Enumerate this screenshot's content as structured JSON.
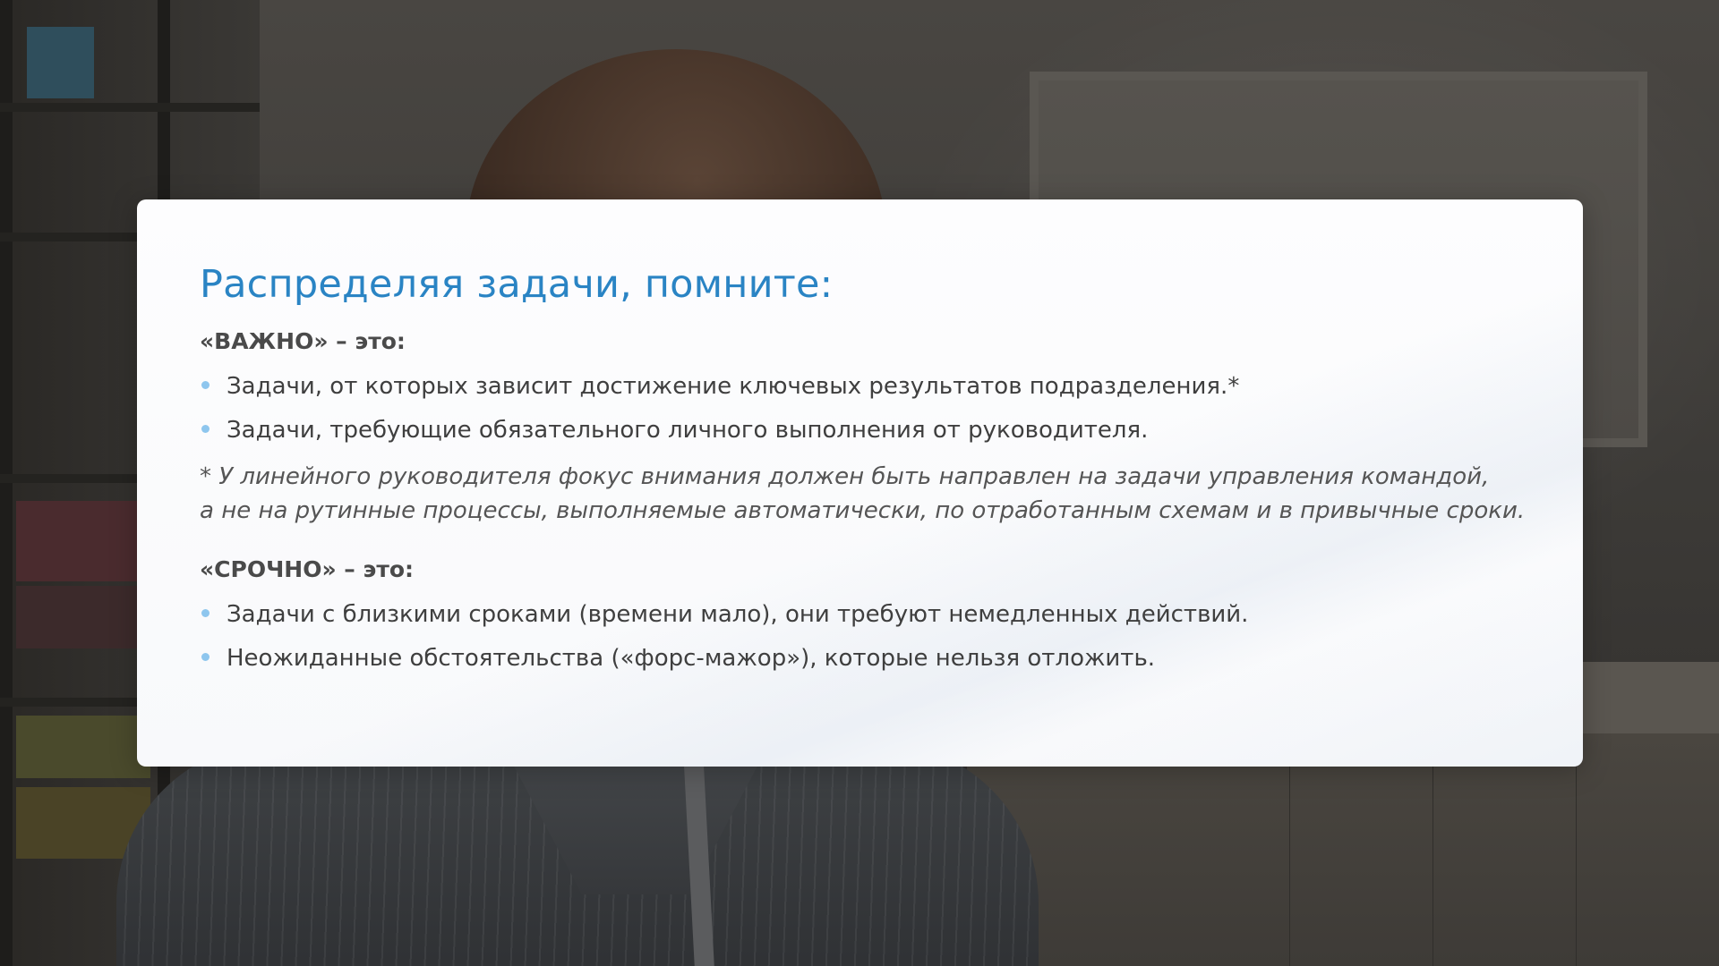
{
  "slide": {
    "title": "Распределяя задачи, помните:",
    "important": {
      "heading": "«ВАЖНО» – это:",
      "items": [
        "Задачи, от которых зависит достижение ключевых результатов подразделения.*",
        "Задачи, требующие обязательного личного выполнения от руководителя."
      ],
      "footnote_lines": [
        "* У линейного руководителя фокус внимания должен быть направлен на задачи управления командой,",
        "а не на рутинные процессы, выполняемые автоматически, по отработанным схемам и в привычные сроки."
      ]
    },
    "urgent": {
      "heading": "«СРОЧНО» – это:",
      "items": [
        "Задачи с близкими сроками (времени мало), они требуют немедленных действий.",
        "Неожиданные обстоятельства («форс-мажор»), которые нельзя отложить."
      ]
    }
  },
  "colors": {
    "title": "#2a84c4",
    "bullet": "#8ec6ee",
    "card_background": "#fdfdfe",
    "body_text": "#3f3f3f"
  }
}
